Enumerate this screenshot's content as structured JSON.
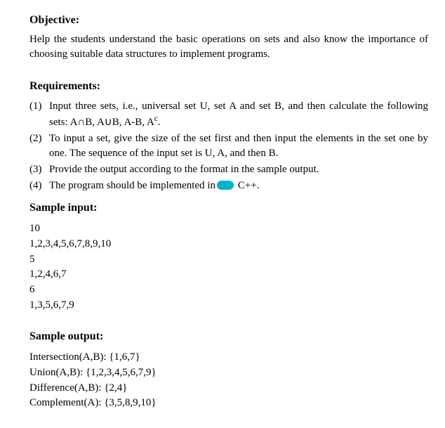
{
  "objective": {
    "heading": "Objective:",
    "body": "Help the students understand the basic operations on sets and also know the importance of choosing suitable data structures to implement programs."
  },
  "requirements": {
    "heading": "Requirements:",
    "items": [
      {
        "num": "(1)",
        "text_pre": "Input three sets, i.e., universal set U, set A and set B, and then calculate the following sets: A",
        "text_post1": "B, A",
        "text_post2": "B, A-B, A",
        "text_tail": ".",
        "op_inter": "∩",
        "op_union": "∪",
        "op_comp_sup": "c"
      },
      {
        "num": "(2)",
        "text": "To input a set, give the size of the set first and then input the elements in the set one by one. The sequence of the input set is U, A, and then B."
      },
      {
        "num": "(3)",
        "text": "Provide the output according to the format in the sample output."
      },
      {
        "num": "(4)",
        "text_pre": "The program should be implemented in",
        "text_post": " C++."
      }
    ]
  },
  "sample_input": {
    "heading": "Sample input:",
    "lines": [
      "10",
      "1,2,3,4,5,6,7,8,9,10",
      "5",
      "1,2,4,6,7",
      "6",
      "1,3,5,6,7,9"
    ]
  },
  "sample_output": {
    "heading": "Sample output:",
    "lines": [
      "Intersection(A,B): {1,6,7}",
      "Union(A,B): {1,2,3,4,5,6,7,9}",
      "Difference(A,B): {2,4}",
      "Complement(A): {3,5,8,9,10}"
    ]
  },
  "chart_data": {
    "type": "table",
    "title": "Programming assignment: basic set operations (A∩B, A∪B, A−B, Aᶜ)",
    "sets": {
      "U": [
        1,
        2,
        3,
        4,
        5,
        6,
        7,
        8,
        9,
        10
      ],
      "A": [
        1,
        2,
        4,
        6,
        7
      ],
      "B": [
        1,
        3,
        5,
        6,
        7,
        9
      ]
    },
    "sample_output": {
      "Intersection(A,B)": [
        1,
        6,
        7
      ],
      "Union(A,B)": [
        1,
        2,
        3,
        4,
        5,
        6,
        7,
        9
      ],
      "Difference(A,B)": [
        2,
        4
      ],
      "Complement(A)": [
        3,
        5,
        8,
        9,
        10
      ]
    }
  }
}
